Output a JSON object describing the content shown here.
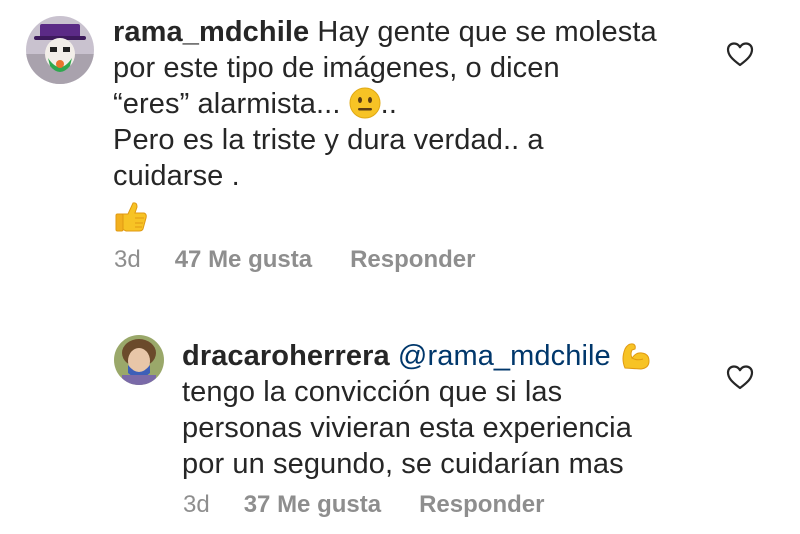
{
  "comments": [
    {
      "username": "rama_mdchile",
      "line1": " Hay gente que se molesta",
      "line2": "por este tipo de imágenes, o dicen",
      "line3": "“eres” alarmista... ",
      "line3_after_emoji": "..",
      "line4": "Pero es la triste y dura verdad.. a",
      "line5": "cuidarse .",
      "time": "3d",
      "likes": "47 Me gusta",
      "reply": "Responder",
      "emojis": [
        "neutral-face-emoji",
        "thumbs-up-emoji"
      ],
      "heart_icon": "heart-outline-icon"
    },
    {
      "username": "dracaroherrera",
      "mention": "@rama_mdchile",
      "line2": "tengo la convicción que si las",
      "line3": "personas vivieran esta experiencia",
      "line4": "por un segundo, se cuidarían mas",
      "time": "3d",
      "likes": "37 Me gusta",
      "reply": "Responder",
      "emojis": [
        "flexed-biceps-emoji"
      ],
      "heart_icon": "heart-outline-icon"
    }
  ],
  "colors": {
    "text": "#262626",
    "meta": "#8e8e8e",
    "mention": "#00376b",
    "emoji_yellow": "#f7c325"
  }
}
